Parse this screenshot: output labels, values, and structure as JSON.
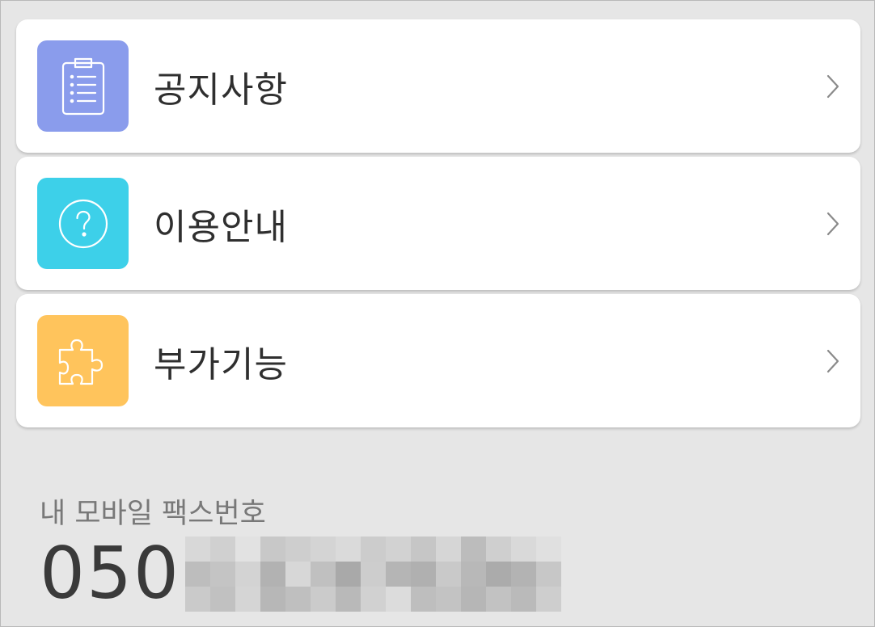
{
  "menu": [
    {
      "id": "notice",
      "label": "공지사항",
      "icon": "clipboard-list-icon",
      "color": "#8a9cec"
    },
    {
      "id": "guide",
      "label": "이용안내",
      "icon": "question-circle-icon",
      "color": "#3dd0e9"
    },
    {
      "id": "addon",
      "label": "부가기능",
      "icon": "puzzle-piece-icon",
      "color": "#ffc45c"
    }
  ],
  "fax": {
    "label": "내 모바일 팩스번호",
    "prefix": "050"
  }
}
